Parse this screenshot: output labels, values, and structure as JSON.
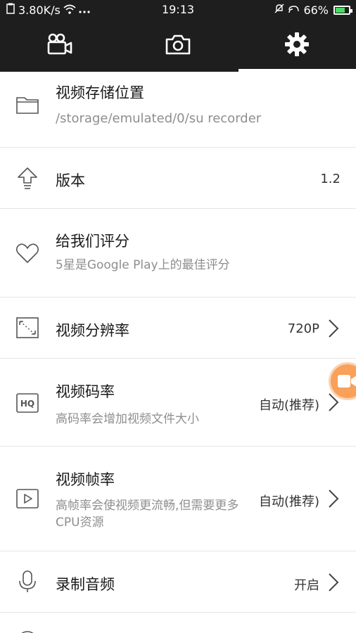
{
  "status_bar": {
    "speed": "3.80K/s",
    "time": "19:13",
    "battery": "66%"
  },
  "tabs": [
    {
      "name": "video-camera-icon"
    },
    {
      "name": "camera-icon"
    },
    {
      "name": "gear-icon",
      "active": true
    }
  ],
  "settings": {
    "storage": {
      "title": "视频存储位置",
      "path": "/storage/emulated/0/su recorder"
    },
    "version": {
      "title": "版本",
      "value": "1.2"
    },
    "rate": {
      "title": "给我们评分",
      "subtitle": "5星是Google Play上的最佳评分"
    },
    "resolution": {
      "title": "视频分辨率",
      "value": "720P"
    },
    "bitrate": {
      "title": "视频码率",
      "subtitle": "高码率会增加视频文件大小",
      "value": "自动(推荐)",
      "icon_text": "HQ"
    },
    "framerate": {
      "title": "视频帧率",
      "subtitle": "高帧率会使视频更流畅,但需要更多CPU资源",
      "value": "自动(推荐)"
    },
    "audio": {
      "title": "录制音频",
      "value": "开启"
    }
  },
  "colors": {
    "bar": "#1e1e1e",
    "accent_fab": "#f9a05a",
    "battery": "#4cd964"
  }
}
